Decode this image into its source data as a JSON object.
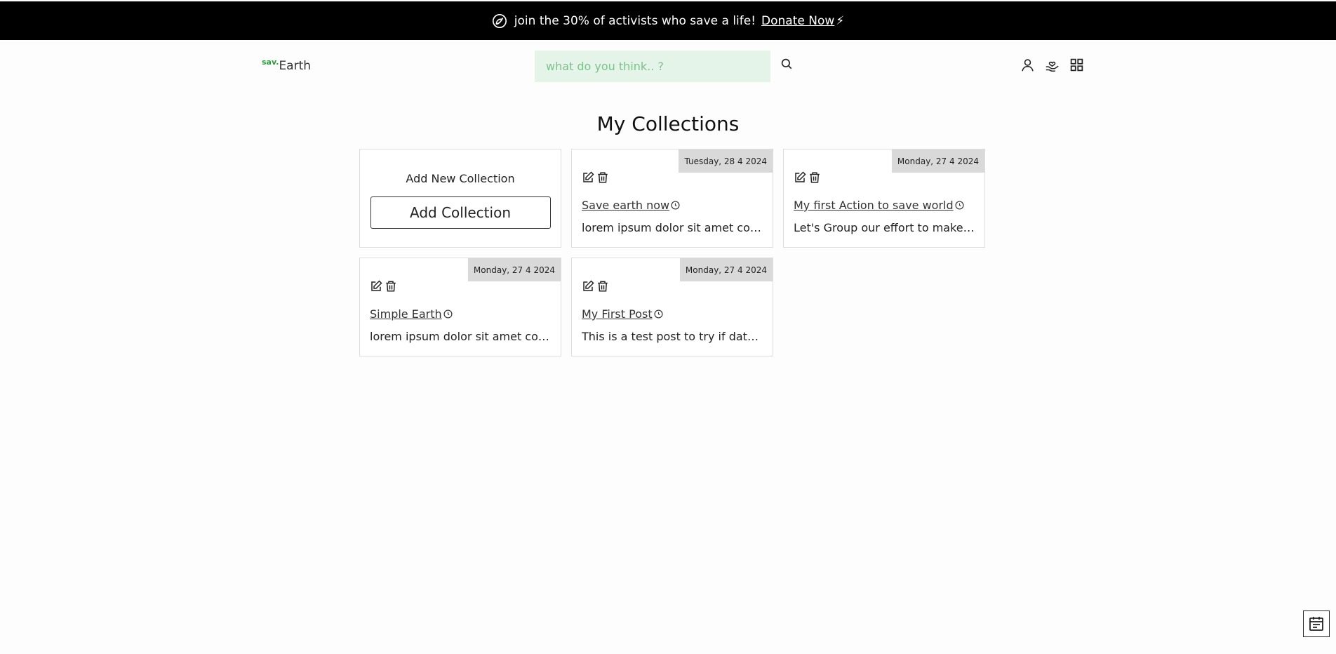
{
  "banner": {
    "message": "join the 30% of activists who save a life!",
    "donate_label": "Donate Now",
    "icons": [
      "leaf-icon",
      "bolt-icon"
    ]
  },
  "header": {
    "logo_super": "sav.",
    "logo_main": "Earth",
    "search": {
      "placeholder": "what do you think.. ?",
      "value": ""
    },
    "icons": [
      "search-icon",
      "user-icon",
      "donate-hand-icon",
      "grid-menu-icon"
    ]
  },
  "page": {
    "title": "My Collections"
  },
  "add_card": {
    "label": "Add New Collection",
    "button_label": "Add Collection"
  },
  "collections": [
    {
      "date": "Tuesday, 28 4 2024",
      "title": "Save earth now",
      "description": "lorem ipsum dolor sit amet con..."
    },
    {
      "date": "Monday, 27 4 2024",
      "title": "My first Action to save world",
      "description": "Let's Group our effort to make s..."
    },
    {
      "date": "Monday, 27 4 2024",
      "title": "Simple Earth",
      "description": "lorem ipsum dolor sit amet con..."
    },
    {
      "date": "Monday, 27 4 2024",
      "title": "My First Post",
      "description": "This is a test post to try if datab..."
    }
  ],
  "colors": {
    "banner_bg": "#000000",
    "accent_green": "#2a9d3a",
    "search_bg": "#e5f4e8",
    "date_bg": "#d9d9d9"
  }
}
